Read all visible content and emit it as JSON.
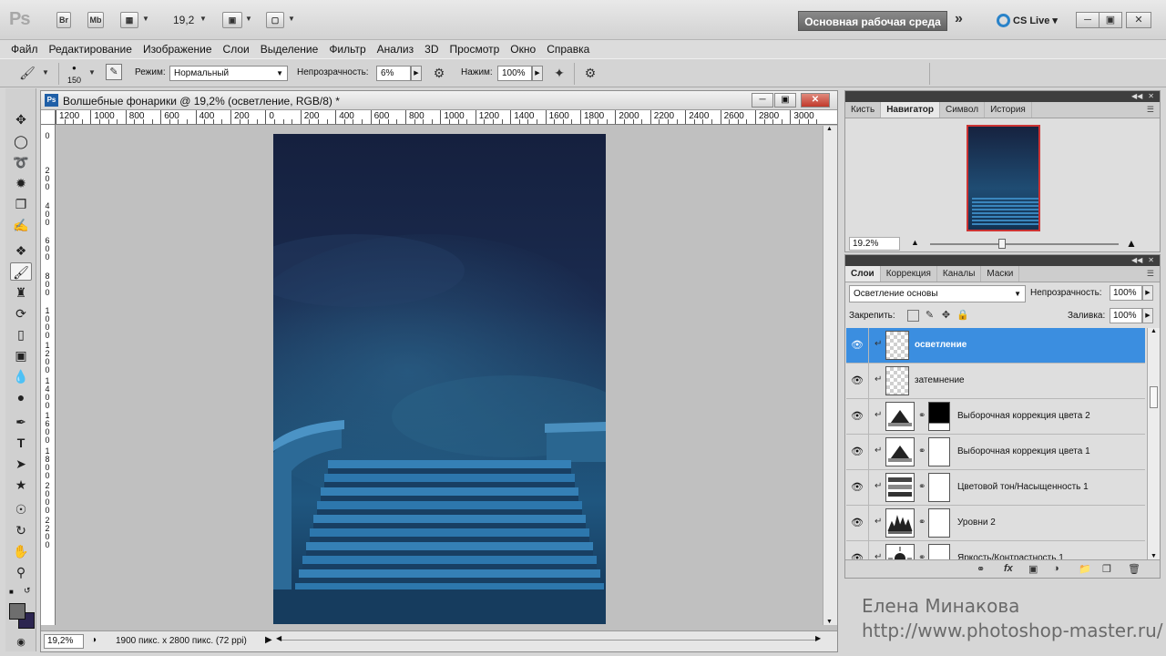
{
  "app": {
    "logo": "Ps",
    "bridge_label": "Br",
    "minibridge_label": "Mb",
    "zoom_display": "19,2",
    "workspace_button": "Основная рабочая среда",
    "more_label": "»",
    "cslive_label": "CS Live"
  },
  "menu": [
    "Файл",
    "Редактирование",
    "Изображение",
    "Слои",
    "Выделение",
    "Фильтр",
    "Анализ",
    "3D",
    "Просмотр",
    "Окно",
    "Справка"
  ],
  "options": {
    "brush_size": "150",
    "mode_label": "Режим:",
    "mode_value": "Нормальный",
    "opacity_label": "Непрозрачность:",
    "opacity_value": "6%",
    "flow_label": "Нажим:",
    "flow_value": "100%"
  },
  "document": {
    "title": "Волшебные фонарики @ 19,2% (осветление, RGB/8) *",
    "ruler_labels": [
      "1200",
      "1000",
      "800",
      "600",
      "400",
      "200",
      "0",
      "200",
      "400",
      "600",
      "800",
      "1000",
      "1200",
      "1400",
      "1600",
      "1800",
      "2000",
      "2200",
      "2400",
      "2600",
      "2800",
      "3000"
    ],
    "vruler_labels": [
      "0",
      "200",
      "400",
      "600",
      "800",
      "1000",
      "1200",
      "1400",
      "1600",
      "1800",
      "2000",
      "2200"
    ],
    "zoom": "19,2%",
    "info": "1900 пикс. x 2800 пикс. (72 ppi)"
  },
  "nav_panel": {
    "tabs": [
      "Кисть",
      "Навигатор",
      "Символ",
      "История"
    ],
    "active_tab": "Навигатор",
    "zoom": "19.2%"
  },
  "layers_panel": {
    "tabs": [
      "Слои",
      "Коррекция",
      "Каналы",
      "Маски"
    ],
    "active_tab": "Слои",
    "blend_mode": "Осветление основы",
    "opacity_label": "Непрозрачность:",
    "opacity_value": "100%",
    "lock_label": "Закрепить:",
    "fill_label": "Заливка:",
    "fill_value": "100%",
    "layers": [
      {
        "name": "осветление",
        "kind": "pixel",
        "selected": true
      },
      {
        "name": "затемнение",
        "kind": "pixel",
        "selected": false
      },
      {
        "name": "Выборочная коррекция цвета 2",
        "kind": "selective",
        "mask": "black",
        "selected": false
      },
      {
        "name": "Выборочная коррекция цвета 1",
        "kind": "selective",
        "mask": "white",
        "selected": false
      },
      {
        "name": "Цветовой тон/Насыщенность 1",
        "kind": "huesat",
        "mask": "white",
        "selected": false
      },
      {
        "name": "Уровни 2",
        "kind": "levels",
        "mask": "white",
        "selected": false
      },
      {
        "name": "Яркость/Контрастность 1",
        "kind": "brightness",
        "mask": "white",
        "selected": false
      }
    ]
  },
  "credit": {
    "author": "Елена Минакова",
    "url": "http://www.photoshop-master.ru/"
  },
  "colors": {
    "selection": "#3b8ee0",
    "foreground": "#6e6e6e",
    "background": "#2c2550"
  }
}
